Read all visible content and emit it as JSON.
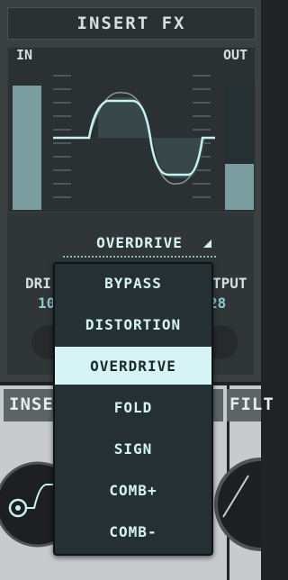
{
  "panel": {
    "title": "INSERT FX",
    "in_label": "IN",
    "out_label": "OUT",
    "mode": "OVERDRIVE",
    "params": {
      "left_label_fragment": "DRI",
      "left_value_fragment": "10",
      "right_label_fragment": "TPUT",
      "right_value_fragment": "28"
    }
  },
  "menu": {
    "items": [
      "BYPASS",
      "DISTORTION",
      "OVERDRIVE",
      "FOLD",
      "SIGN",
      "COMB+",
      "COMB-"
    ],
    "selected": "OVERDRIVE"
  },
  "modules": {
    "left_title_fragment": "INSE",
    "right_title_fragment": "FILT"
  },
  "colors": {
    "accent": "#d6f4f6",
    "panel": "#3a3f40",
    "meter": "#7c9da0"
  }
}
